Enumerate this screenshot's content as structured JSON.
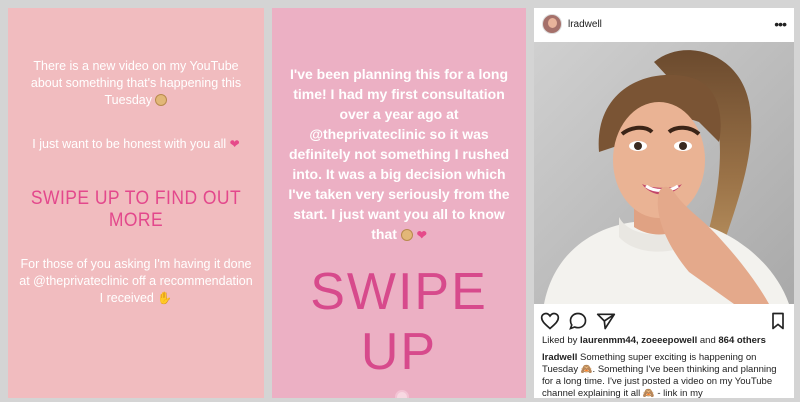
{
  "story1": {
    "line1": "There is a new video on my YouTube about something that's happening this Tuesday",
    "line2": "I just want to be honest with you all",
    "swipe": "SWIPE UP TO FIND OUT MORE",
    "line3": "For those of you asking I'm having it done at @theprivateclinic off a recommendation I received",
    "background_color": "#f1bcbf",
    "accent_color": "#e3488c"
  },
  "story2": {
    "text": "I've been planning this for a long time! I had my first consultation over a year ago at @theprivateclinic so it was definitely not something I rushed into. It was a big decision which I've taken very seriously from the start. I just want you all to know that",
    "swipe": "SWIPE UP",
    "background_color": "#ecb0c4",
    "accent_color": "#d74a8c"
  },
  "post": {
    "username": "lradwell",
    "more_icon": "ellipsis-icon",
    "likes_prefix": "Liked by ",
    "likes_users": "laurenmm44, zoeeepowell",
    "likes_and": " and ",
    "likes_count": "864 others",
    "caption_user": "lradwell",
    "caption_text": " Something super exciting is happening on Tuesday 🙈. Something I've been thinking and planning for a long time. I've just posted a video on my YouTube channel explaining it all 🙈 - link in my",
    "icons": [
      "heart-icon",
      "comment-icon",
      "share-icon",
      "bookmark-icon"
    ]
  }
}
